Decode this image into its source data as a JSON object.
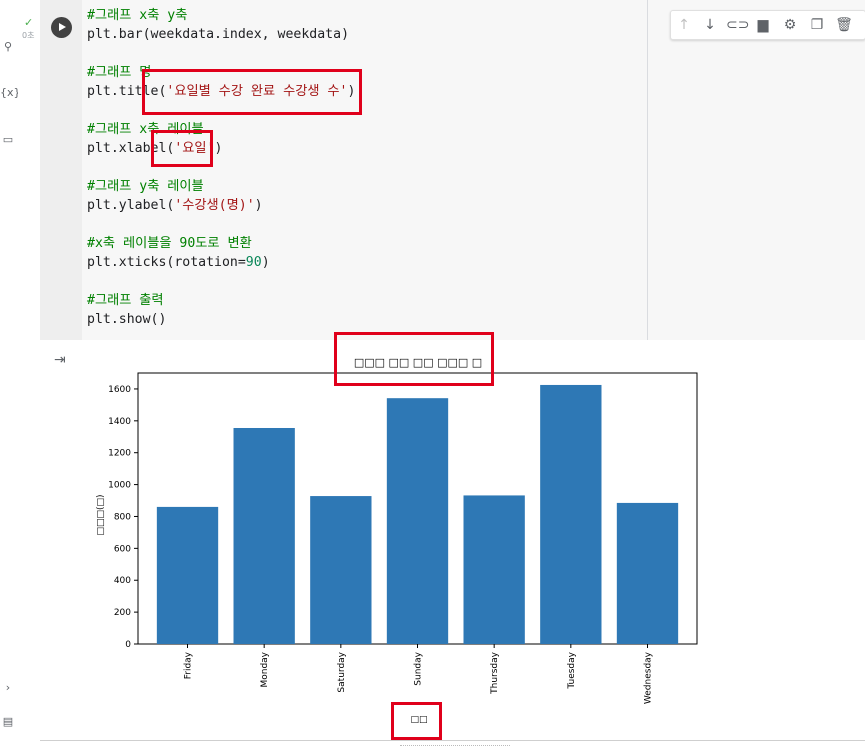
{
  "sidebar": {
    "elapsed": "0초",
    "vars_icon": "{x}"
  },
  "code_lines": [
    {
      "c": "#그래프 x축 y축"
    },
    {
      "t": "plt.bar(weekdata.index, weekdata)"
    },
    {},
    {
      "c": "#그래프 명"
    },
    {
      "t": "plt.title(",
      "s": "'요일별 수강 완료 수강생 수'",
      "t2": ")"
    },
    {},
    {
      "c": "#그래프 x축 레이블"
    },
    {
      "t": "plt.xlabel(",
      "s": "'요일'",
      "t2": ")"
    },
    {},
    {
      "c": "#그래프 y축 레이블"
    },
    {
      "t": "plt.ylabel(",
      "s": "'수강생(명)'",
      "t2": ")"
    },
    {},
    {
      "c": "#x축 레이블을 90도로 변환"
    },
    {
      "t": "plt.xticks(rotation=",
      "n": "90",
      "t2": ")"
    },
    {},
    {
      "c": "#그래프 출력"
    },
    {
      "t": "plt.show()"
    }
  ],
  "toolbar": [
    "arrow-up-icon",
    "arrow-down-icon",
    "link-icon",
    "comment-icon",
    "settings-icon",
    "mirror-icon",
    "delete-icon"
  ],
  "chart_data": {
    "type": "bar",
    "title": "□□□ □□ □□ □□□ □",
    "xlabel": "□□",
    "ylabel": "□□□(□)",
    "categories": [
      "Friday",
      "Monday",
      "Saturday",
      "Sunday",
      "Thursday",
      "Tuesday",
      "Wednesday"
    ],
    "values": [
      860,
      1355,
      928,
      1542,
      932,
      1625,
      885
    ],
    "ylim": [
      0,
      1700
    ],
    "yticks": [
      0,
      200,
      400,
      600,
      800,
      1000,
      1200,
      1400,
      1600
    ],
    "bar_color": "#2e78b5",
    "grid": false
  },
  "colors": {
    "highlight": "#e0001b",
    "bar": "#2e78b5",
    "comment": "#008000",
    "string": "#a31515",
    "number": "#098658"
  }
}
